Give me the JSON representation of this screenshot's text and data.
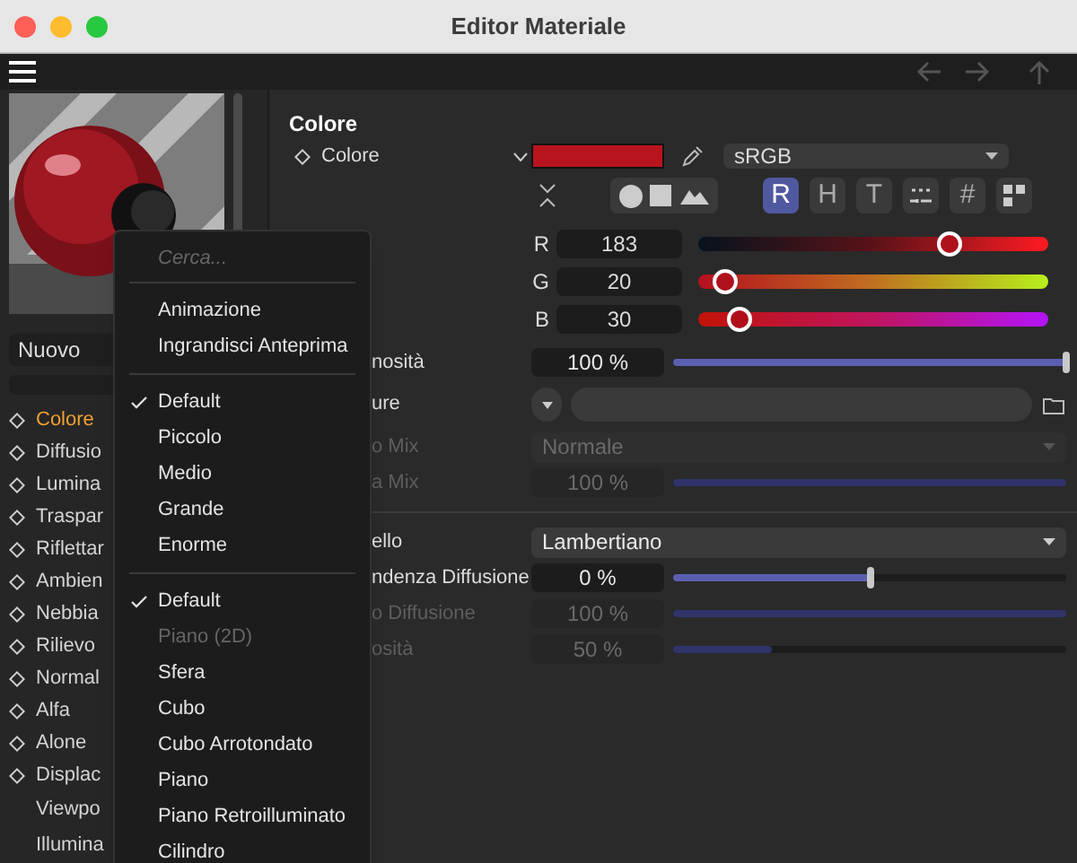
{
  "window": {
    "title": "Editor Materiale"
  },
  "sidebar": {
    "name_field": {
      "value": "Nuovo"
    },
    "items": [
      {
        "label": "Colore",
        "kind": "channel",
        "selected": true
      },
      {
        "label": "Diffusio",
        "kind": "channel",
        "selected": false
      },
      {
        "label": "Lumina",
        "kind": "channel",
        "selected": false
      },
      {
        "label": "Traspar",
        "kind": "channel",
        "selected": false
      },
      {
        "label": "Riflettar",
        "kind": "channel",
        "selected": false
      },
      {
        "label": "Ambien",
        "kind": "channel",
        "selected": false
      },
      {
        "label": "Nebbia",
        "kind": "channel",
        "selected": false
      },
      {
        "label": "Rilievo",
        "kind": "channel",
        "selected": false
      },
      {
        "label": "Normal",
        "kind": "channel",
        "selected": false
      },
      {
        "label": "Alfa",
        "kind": "channel",
        "selected": false
      },
      {
        "label": "Alone",
        "kind": "channel",
        "selected": false
      },
      {
        "label": "Displac",
        "kind": "channel",
        "selected": false
      },
      {
        "label": "Viewpo",
        "kind": "plain",
        "selected": false
      },
      {
        "label": "Illumina",
        "kind": "plain",
        "selected": false
      }
    ]
  },
  "context_menu": {
    "search": {
      "placeholder": "Cerca..."
    },
    "sections": [
      [
        {
          "label": "Animazione",
          "checked": false,
          "disabled": false
        },
        {
          "label": "Ingrandisci Anteprima",
          "checked": false,
          "disabled": false
        }
      ],
      [
        {
          "label": "Default",
          "checked": true,
          "disabled": false
        },
        {
          "label": "Piccolo",
          "checked": false,
          "disabled": false
        },
        {
          "label": "Medio",
          "checked": false,
          "disabled": false
        },
        {
          "label": "Grande",
          "checked": false,
          "disabled": false
        },
        {
          "label": "Enorme",
          "checked": false,
          "disabled": false
        }
      ],
      [
        {
          "label": "Default",
          "checked": true,
          "disabled": false
        },
        {
          "label": "Piano (2D)",
          "checked": false,
          "disabled": true
        },
        {
          "label": "Sfera",
          "checked": false,
          "disabled": false
        },
        {
          "label": "Cubo",
          "checked": false,
          "disabled": false
        },
        {
          "label": "Cubo Arrotondato",
          "checked": false,
          "disabled": false
        },
        {
          "label": "Piano",
          "checked": false,
          "disabled": false
        },
        {
          "label": "Piano Retroilluminato",
          "checked": false,
          "disabled": false
        },
        {
          "label": "Cilindro",
          "checked": false,
          "disabled": false
        }
      ]
    ]
  },
  "panel": {
    "heading": "Colore",
    "color": {
      "label": "Colore",
      "color_space": "sRGB"
    },
    "modes": [
      {
        "kind": "text",
        "label": "R",
        "selected": true
      },
      {
        "kind": "text",
        "label": "H",
        "selected": false
      },
      {
        "kind": "text",
        "label": "T",
        "selected": false
      },
      {
        "kind": "mixer",
        "selected": false
      },
      {
        "kind": "text",
        "label": "#",
        "selected": false
      },
      {
        "kind": "swatches",
        "selected": false
      }
    ],
    "channels": [
      {
        "label": "R",
        "value": "183",
        "level": 0.717
      },
      {
        "label": "G",
        "value": "20",
        "level": 0.078
      },
      {
        "label": "B",
        "value": "30",
        "level": 0.118
      }
    ],
    "rows": [
      {
        "kind": "slider",
        "label": "nosità",
        "value": "100 %",
        "level": 1,
        "disabled": false
      },
      {
        "kind": "texture",
        "label": "ure",
        "disabled": false
      },
      {
        "kind": "dropdown",
        "label": "o Mix",
        "value": "Normale",
        "disabled": true
      },
      {
        "kind": "slider",
        "label": "a Mix",
        "value": "100 %",
        "level": 1,
        "disabled": true
      },
      {
        "kind": "separator"
      },
      {
        "kind": "dropdown",
        "label": "ello",
        "value": "Lambertiano",
        "disabled": false
      },
      {
        "kind": "slider",
        "label": "ndenza Diffusione",
        "value": "0 %",
        "level": 0.5,
        "disabled": false
      },
      {
        "kind": "slider",
        "label": "o Diffusione",
        "value": "100 %",
        "level": 1,
        "disabled": true
      },
      {
        "kind": "slider",
        "label": "osità",
        "value": "50 %",
        "level": 0.25,
        "disabled": true
      }
    ]
  }
}
